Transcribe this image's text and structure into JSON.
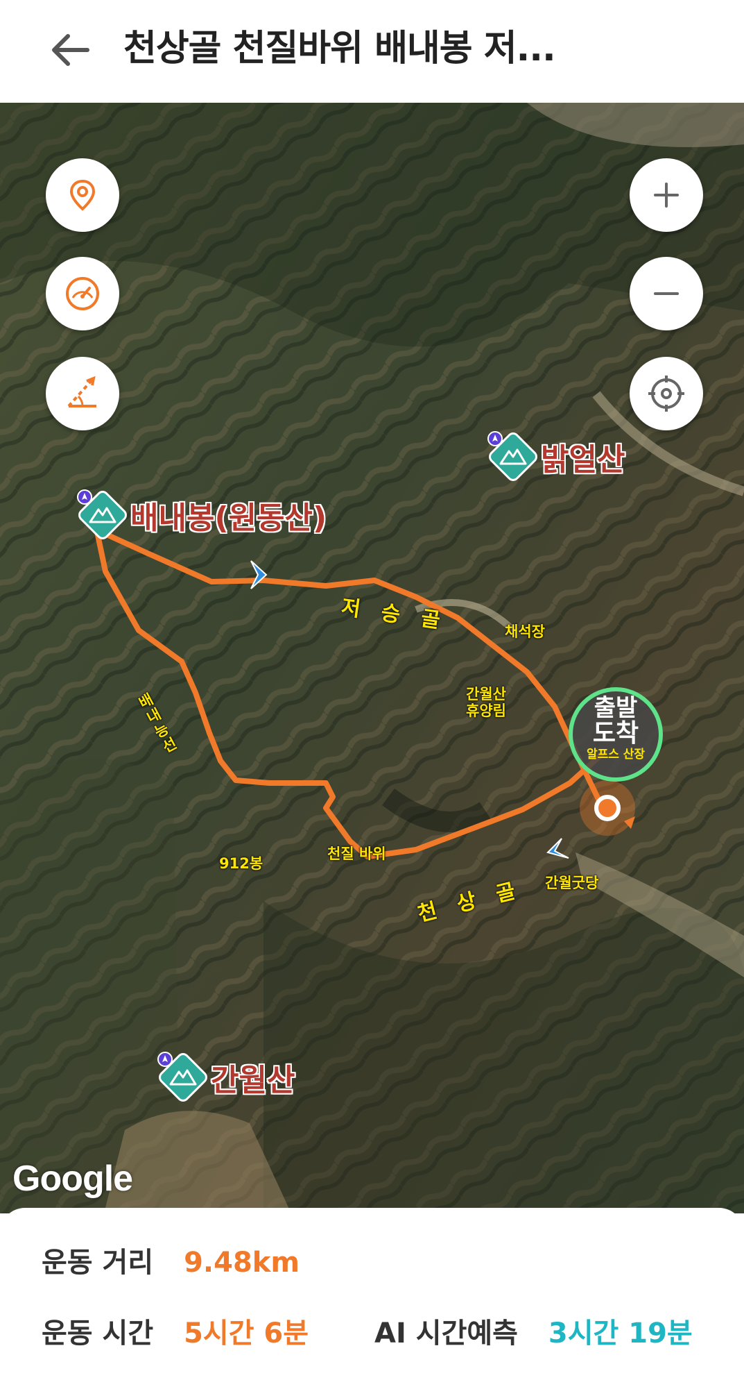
{
  "header": {
    "title": "천상골 천질바위 배내봉 저..."
  },
  "map": {
    "peaks": [
      {
        "name": "밝얼산"
      },
      {
        "name": "배내봉(원동산)"
      },
      {
        "name": "간월산"
      }
    ],
    "labels": {
      "jeoseunggol": "저 승 골",
      "chaeseokjang": "채석장",
      "ganwolsan_forest_1": "간월산",
      "ganwolsan_forest_2": "휴양림",
      "baenae_ridge": "배\n내\n능\n선",
      "peak_912": "912봉",
      "cheonjil_rock": "천질 바위",
      "cheonsanggol": "천 상 골",
      "ganwol_shrine": "간월굿당"
    },
    "start_end": {
      "line1": "출발",
      "line2": "도착",
      "place": "알프스 산장"
    },
    "attribution": "Google"
  },
  "stats": {
    "distance_label": "운동 거리",
    "distance_value": "9.48km",
    "time_label": "운동 시간",
    "time_value": "5시간 6분",
    "ai_label": "AI 시간예측",
    "ai_value": "3시간 19분"
  },
  "colors": {
    "route": "#f07a2a",
    "accent_orange": "#f07a2a",
    "accent_teal": "#1fb6c4",
    "start_ring": "#5ee28a",
    "label_yellow": "#ffe600",
    "peak_marker": "#2ea99a"
  },
  "icons": {
    "back": "arrow-left-icon",
    "location_pin": "location-pin-icon",
    "speedometer": "speedometer-icon",
    "slope": "slope-angle-icon",
    "zoom_in": "plus-icon",
    "zoom_out": "minus-icon",
    "locate": "crosshair-icon",
    "peak": "mountain-icon"
  }
}
